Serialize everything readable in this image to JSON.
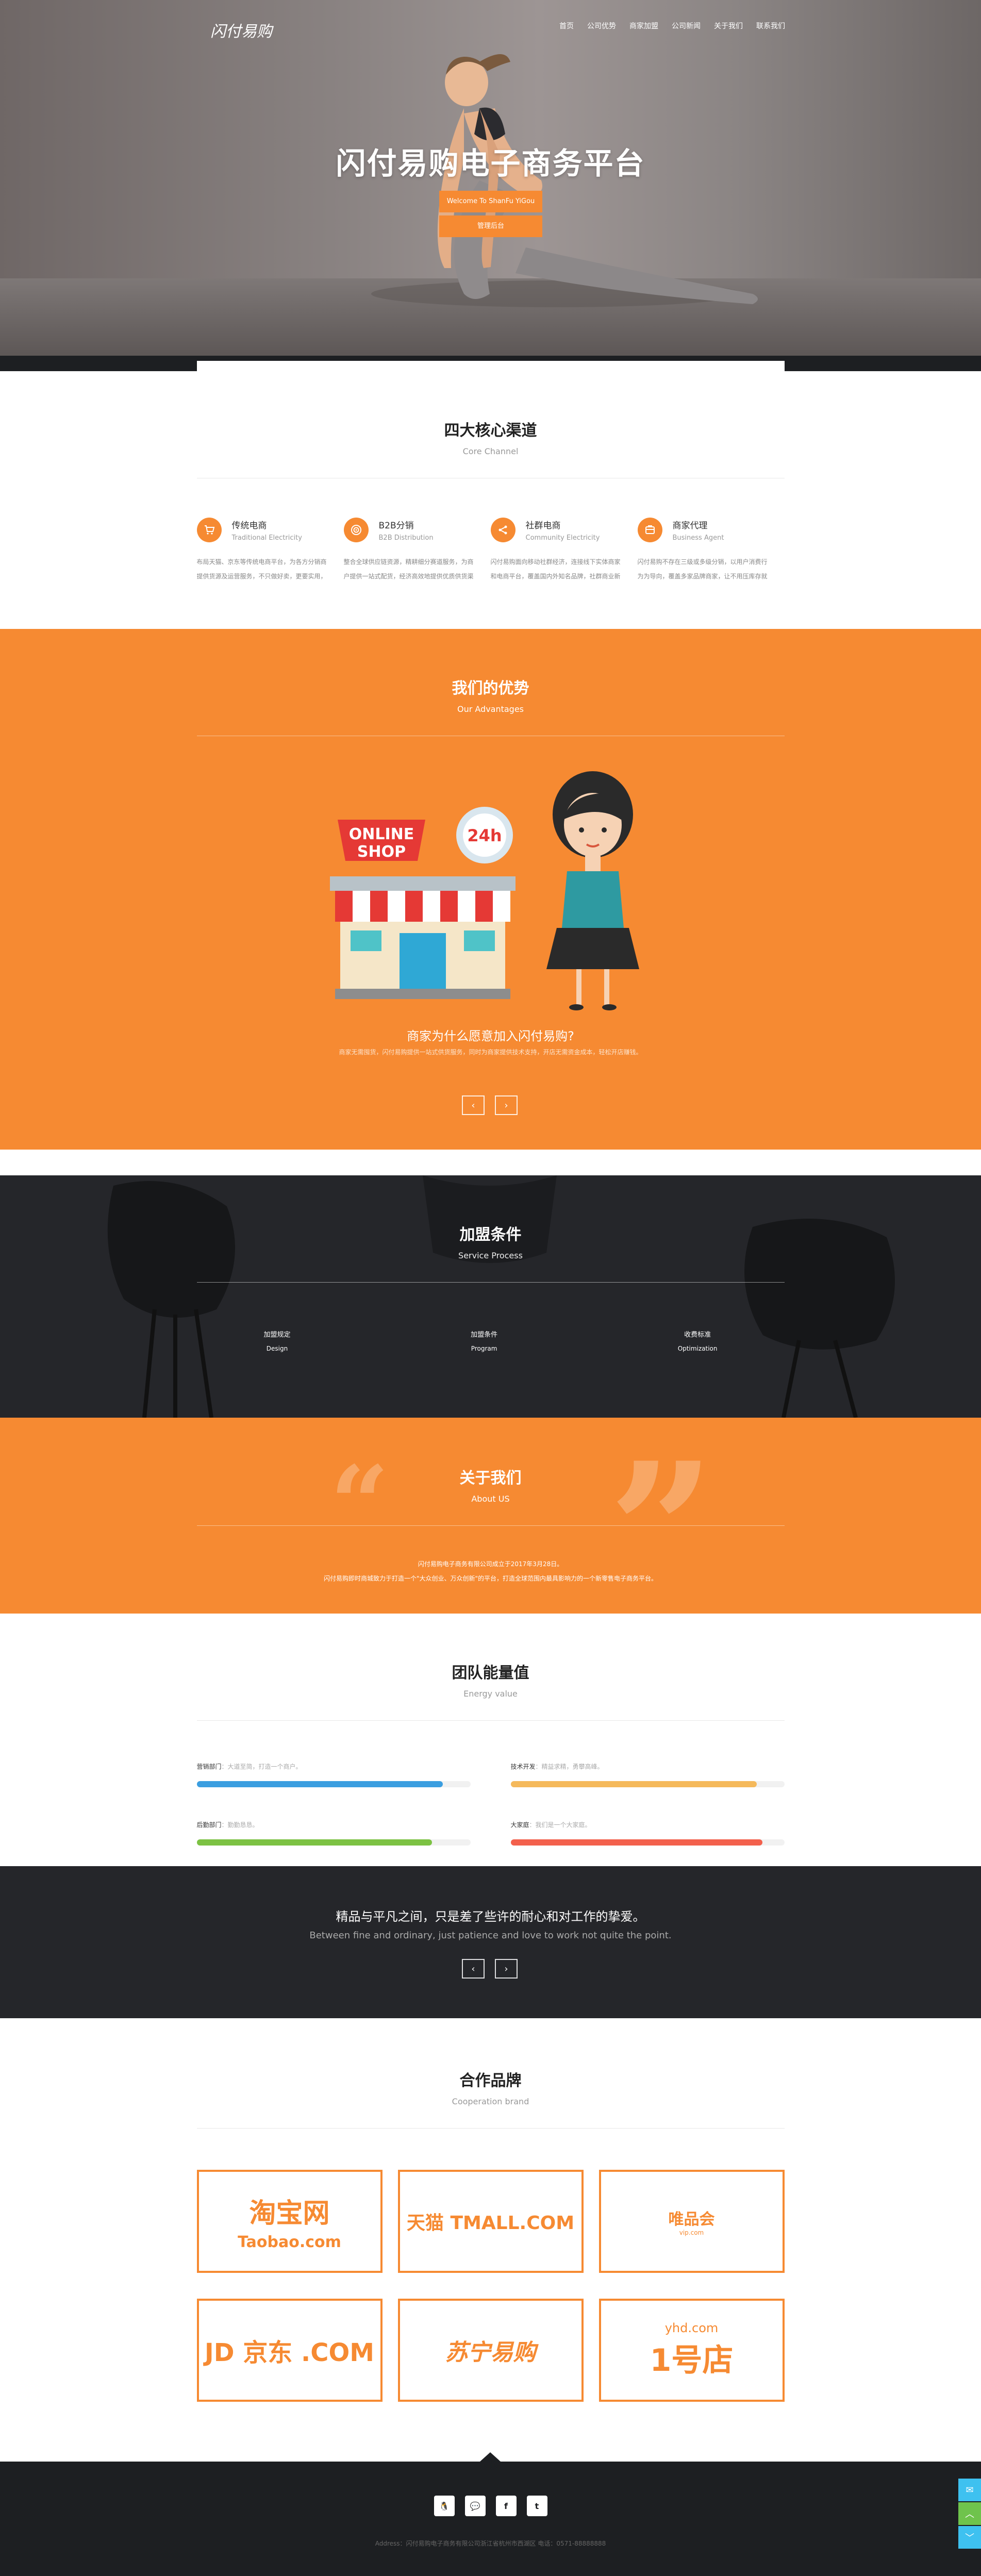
{
  "nav": {
    "logo_text": "闪付易购",
    "items": [
      "首页",
      "公司优势",
      "商家加盟",
      "公司新闻",
      "关于我们",
      "联系我们"
    ]
  },
  "hero": {
    "title": "闪付易购电子商务平台",
    "btn1": "Welcome To ShanFu YiGou",
    "btn2": "管理后台"
  },
  "core": {
    "title": "四大核心渠道",
    "subtitle": "Core Channel",
    "items": [
      {
        "icon": "cart-icon",
        "name": "传统电商",
        "en": "Traditional Electricity",
        "desc": "布局天猫、京东等传统电商平台，为各方分销商提供货源及运营服务，不只做好卖，更要实用，以用户为中心。"
      },
      {
        "icon": "target-icon",
        "name": "B2B分销",
        "en": "B2B Distribution",
        "desc": "整合全球供应链资源，精耕细分赛道服务，为商户提供一站式配货，经济高效地提供优质供货渠道。"
      },
      {
        "icon": "share-icon",
        "name": "社群电商",
        "en": "Community Electricity",
        "desc": "闪付易购面向移动社群经济，连接线下实体商家和电商平台，覆盖国内外知名品牌，社群商业新模式。"
      },
      {
        "icon": "agent-icon",
        "name": "商家代理",
        "en": "Business Agent",
        "desc": "闪付易购不存在三级或多级分销，以用户消费行为为导向，覆盖多家品牌商家，让不用压库存就能轻松赚钱。"
      }
    ]
  },
  "advantage": {
    "title": "我们的优势",
    "subtitle": "Our Advantages",
    "sign_line1": "ONLINE",
    "sign_line2": "SHOP",
    "badge": "24h",
    "question": "商家为什么愿意加入闪付易购?",
    "desc": "商家无需囤货，闪付易购提供一站式供货服务，同时为商家提供技术支持，开店无需资金成本，轻松开店赚钱。",
    "prev": "‹",
    "next": "›"
  },
  "join": {
    "title": "加盟条件",
    "subtitle": "Service Process",
    "items": [
      {
        "cn": "加盟规定",
        "en": "Design"
      },
      {
        "cn": "加盟条件",
        "en": "Program"
      },
      {
        "cn": "收费标准",
        "en": "Optimization"
      }
    ]
  },
  "about": {
    "title": "关于我们",
    "subtitle": "About US",
    "line1": "闪付易购电子商务有限公司成立于2017年3月28日。",
    "line2": "闪付易购即时商城致力于打造一个\"大众创业、万众创新\"的平台，打造全球范围内最具影响力的一个新零售电子商务平台。"
  },
  "team": {
    "title": "团队能量值",
    "subtitle": "Energy value",
    "bars": [
      {
        "name": "营销部门",
        "note": "大道至简，打造一个商户。",
        "value": 0.9,
        "color": "#3b9ee0"
      },
      {
        "name": "技术开发",
        "note": "精益求精，勇攀高峰。",
        "value": 0.9,
        "color": "#f5b95b"
      },
      {
        "name": "后勤部门",
        "note": "勤勤恳恳。",
        "value": 0.86,
        "color": "#7cc243"
      },
      {
        "name": "大家庭",
        "note": "我们是一个大家庭。",
        "value": 0.92,
        "color": "#f3604c"
      }
    ]
  },
  "motto": {
    "cn": "精品与平凡之间，只是差了些许的耐心和对工作的挚爱。",
    "en": "Between fine and ordinary, just patience and love to work not quite the point.",
    "prev": "‹",
    "next": "›"
  },
  "brands": {
    "title": "合作品牌",
    "subtitle": "Cooperation brand",
    "items": [
      {
        "line1": "淘宝网",
        "line2": "Taobao.com"
      },
      {
        "line1": "天猫 TMALL.COM",
        "line2": ""
      },
      {
        "line1": "唯品会",
        "line2": "vip.com"
      },
      {
        "line1": "JD 京东 .COM",
        "line2": ""
      },
      {
        "line1": "苏宁易购",
        "line2": ""
      },
      {
        "line1": "1号店",
        "line2": "yhd.com"
      }
    ]
  },
  "footer": {
    "socials": [
      "qq-icon",
      "wechat-icon",
      "facebook-icon",
      "twitter-icon"
    ],
    "social_glyphs": [
      "🐧",
      "💬",
      "f",
      "t"
    ],
    "address": "Address：闪付易购电子商务有限公司浙江省杭州市西湖区 电话：0571-88888888"
  },
  "side_tools": {
    "colors": [
      "#3ec1f0",
      "#6fc34c",
      "#3ec1f0"
    ],
    "glyphs": [
      "✉",
      "︿",
      "﹀"
    ]
  }
}
